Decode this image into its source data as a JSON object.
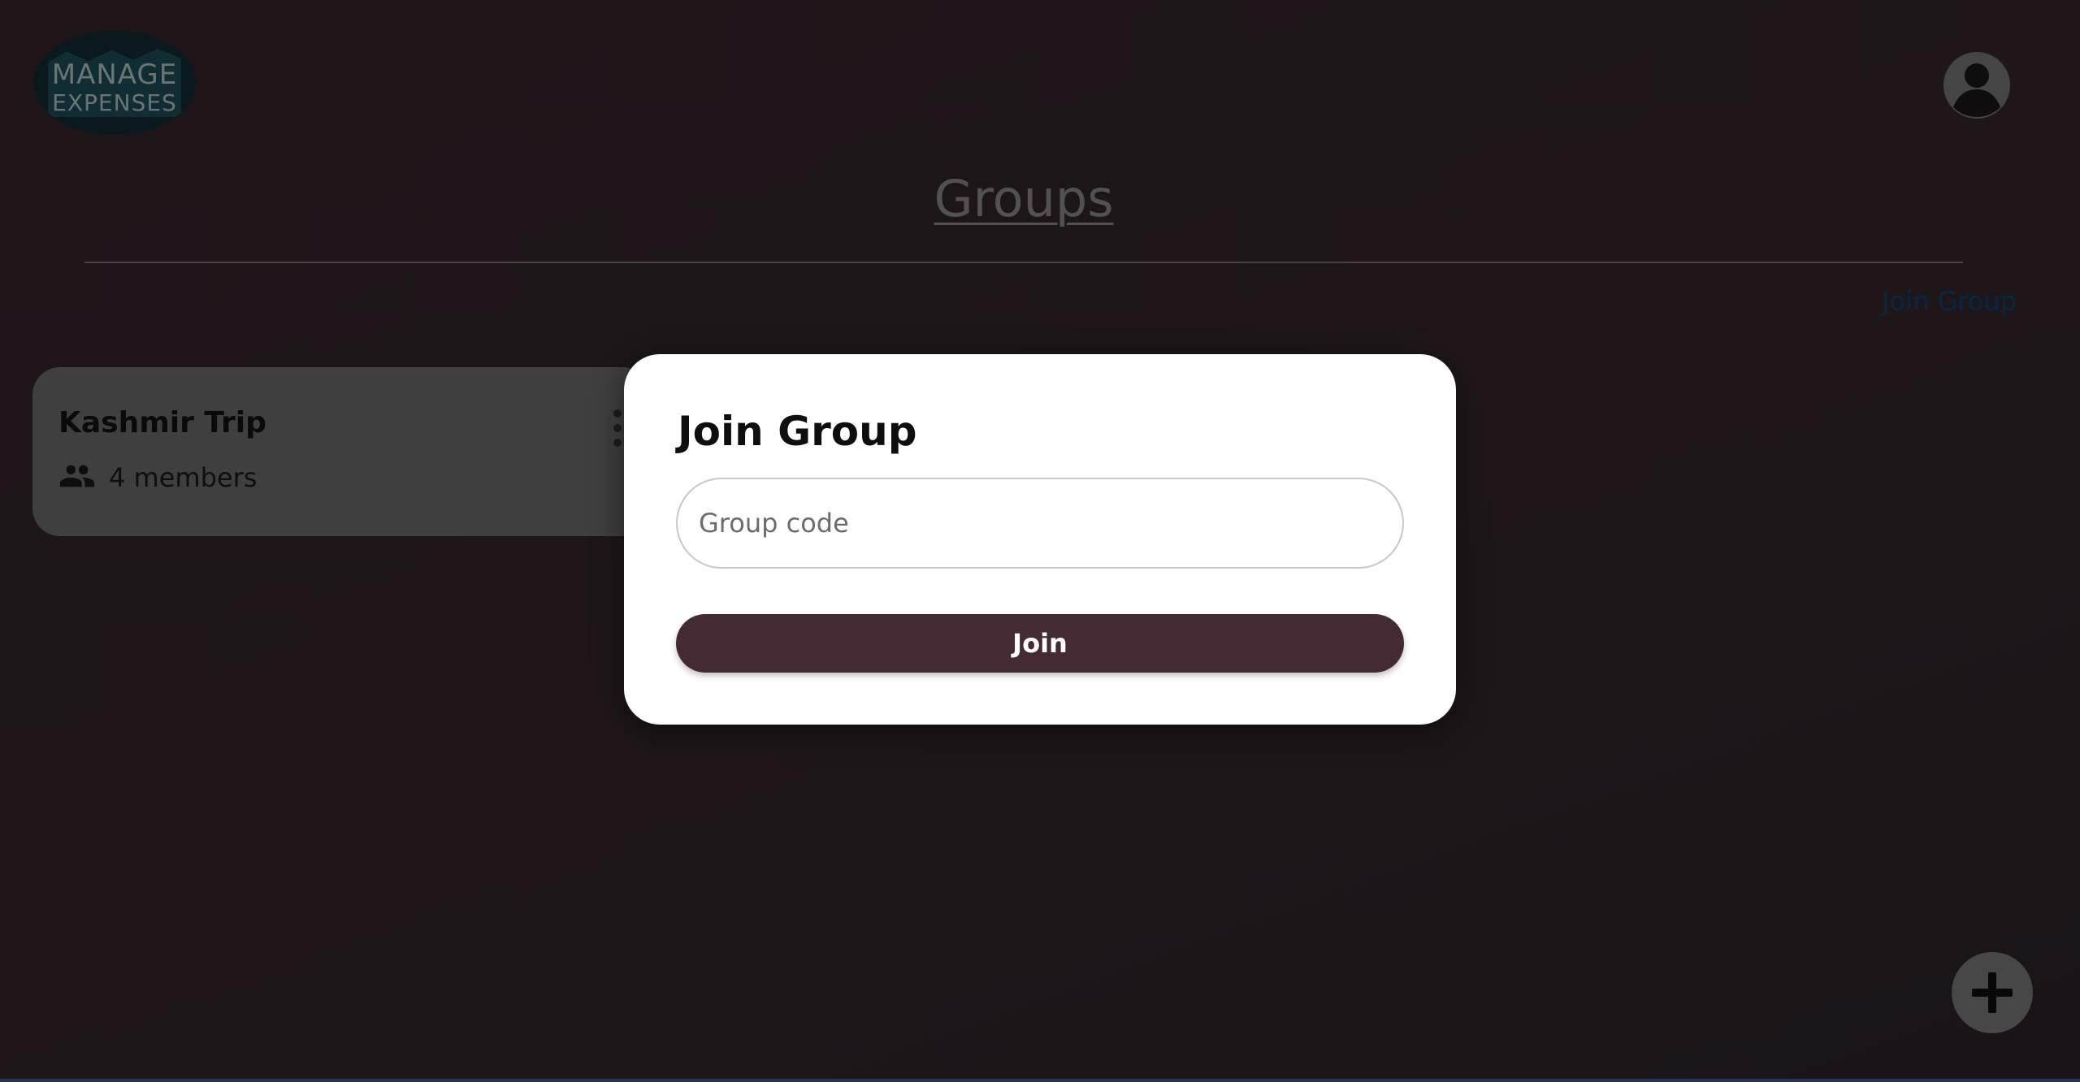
{
  "header": {
    "logo": {
      "line1": "MANAGE",
      "line2": "EXPENSES"
    },
    "profile_icon": "account-circle-icon"
  },
  "page": {
    "title": "Groups",
    "join_link_label": "Join Group"
  },
  "groups": [
    {
      "name": "Kashmir Trip",
      "members_label": "4 members",
      "icon": "people-icon"
    }
  ],
  "fab": {
    "icon": "plus-icon"
  },
  "modal": {
    "title": "Join Group",
    "input": {
      "placeholder": "Group code",
      "value": ""
    },
    "submit_label": "Join"
  },
  "colors": {
    "background": "#1c1418",
    "accent_button": "#442b33",
    "link": "#0b4f86",
    "card": "#7e7e80",
    "modal": "#ffffff"
  }
}
